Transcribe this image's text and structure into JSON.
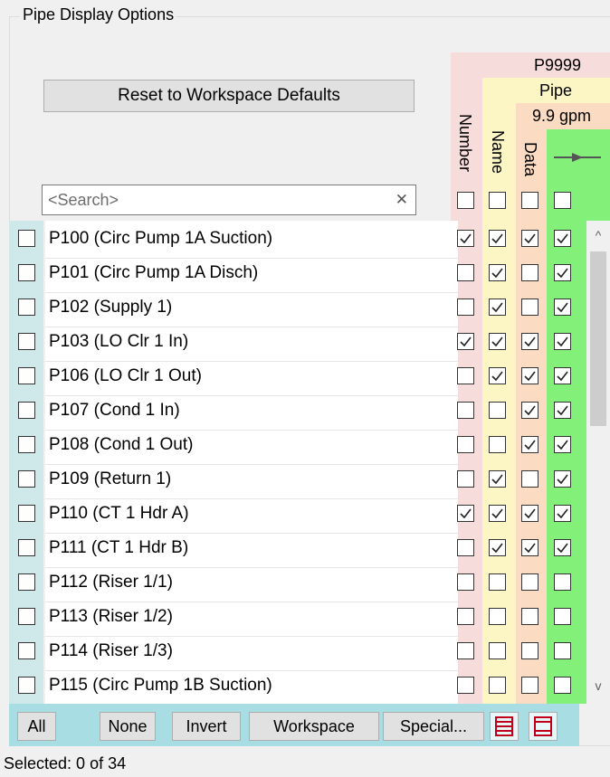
{
  "group": {
    "title": "Pipe Display Options"
  },
  "reset_button": "Reset to Workspace Defaults",
  "preview": {
    "id": "P9999",
    "name": "Pipe",
    "data": "9.9 gpm"
  },
  "columns": {
    "number": "Number",
    "name": "Name",
    "data": "Data"
  },
  "search": {
    "placeholder": "<Search>",
    "value": ""
  },
  "rows": [
    {
      "label": "P100 (Circ Pump 1A Suction)",
      "selected": false,
      "number": true,
      "name": true,
      "data": true,
      "graphic": true
    },
    {
      "label": "P101 (Circ Pump 1A Disch)",
      "selected": false,
      "number": false,
      "name": true,
      "data": false,
      "graphic": true
    },
    {
      "label": "P102 (Supply 1)",
      "selected": false,
      "number": false,
      "name": true,
      "data": false,
      "graphic": true
    },
    {
      "label": "P103 (LO Clr 1 In)",
      "selected": false,
      "number": true,
      "name": true,
      "data": true,
      "graphic": true
    },
    {
      "label": "P106 (LO Clr 1 Out)",
      "selected": false,
      "number": false,
      "name": true,
      "data": true,
      "graphic": true
    },
    {
      "label": "P107 (Cond 1 In)",
      "selected": false,
      "number": false,
      "name": false,
      "data": true,
      "graphic": true
    },
    {
      "label": "P108 (Cond 1 Out)",
      "selected": false,
      "number": false,
      "name": false,
      "data": true,
      "graphic": true
    },
    {
      "label": "P109 (Return 1)",
      "selected": false,
      "number": false,
      "name": true,
      "data": false,
      "graphic": true
    },
    {
      "label": "P110 (CT 1 Hdr A)",
      "selected": false,
      "number": true,
      "name": true,
      "data": true,
      "graphic": true
    },
    {
      "label": "P111 (CT 1 Hdr B)",
      "selected": false,
      "number": false,
      "name": true,
      "data": true,
      "graphic": true
    },
    {
      "label": "P112 (Riser 1/1)",
      "selected": false,
      "number": false,
      "name": false,
      "data": false,
      "graphic": false
    },
    {
      "label": "P113 (Riser 1/2)",
      "selected": false,
      "number": false,
      "name": false,
      "data": false,
      "graphic": false
    },
    {
      "label": "P114 (Riser 1/3)",
      "selected": false,
      "number": false,
      "name": false,
      "data": false,
      "graphic": false
    },
    {
      "label": "P115 (Circ Pump 1B Suction)",
      "selected": false,
      "number": false,
      "name": false,
      "data": false,
      "graphic": false
    }
  ],
  "buttons": {
    "all": "All",
    "none": "None",
    "invert": "Invert",
    "workspace": "Workspace",
    "special": "Special..."
  },
  "status": "Selected: 0 of 34",
  "colors": {
    "number_band": "#f7dcdc",
    "name_band": "#fbf6c3",
    "data_band": "#fbdcc2",
    "graphic_band": "#83f07a",
    "bottom_bar": "#a8dde3"
  },
  "icons": {
    "graphic": "pipe-segment-icon",
    "layout_list": "list-layout-icon",
    "layout_frame": "frame-layout-icon"
  }
}
